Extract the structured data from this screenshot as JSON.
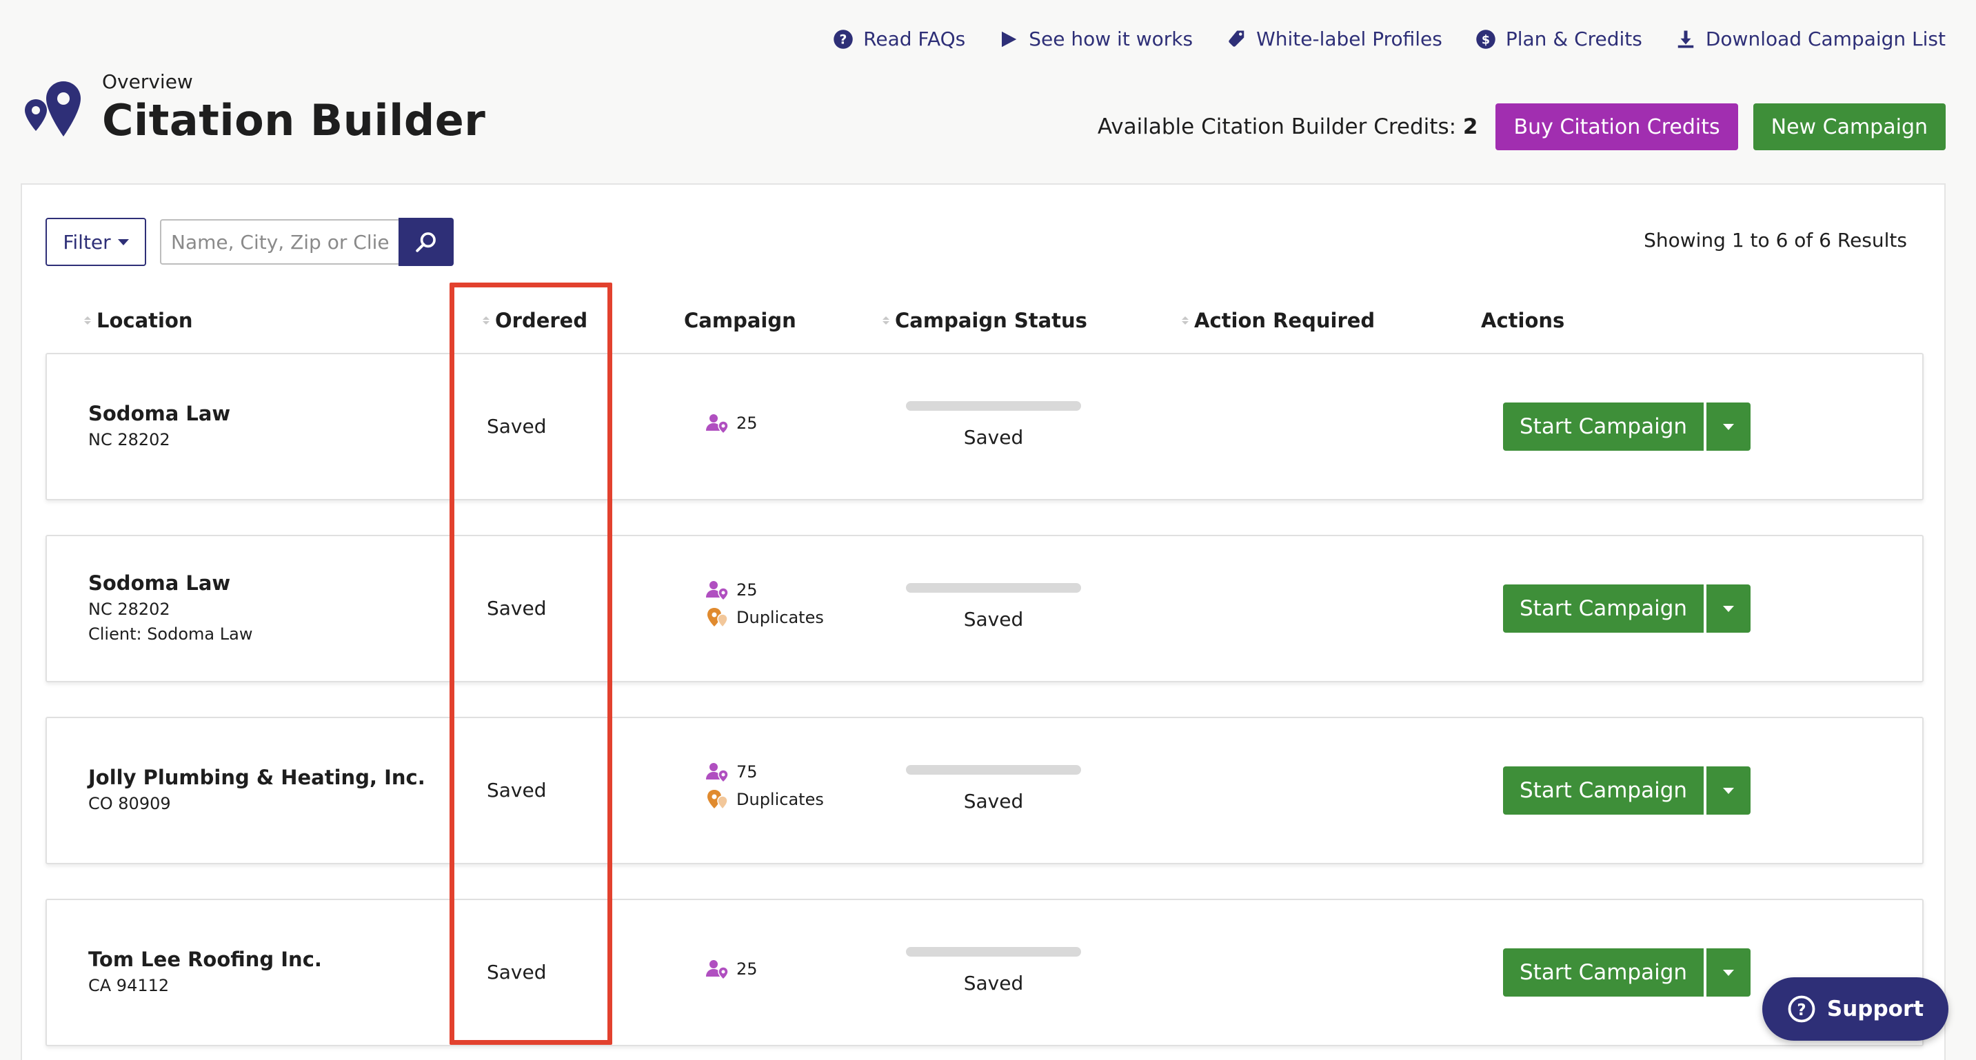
{
  "top_links": [
    {
      "label": "Read FAQs",
      "icon": "question-circle-icon"
    },
    {
      "label": "See how it works",
      "icon": "play-icon"
    },
    {
      "label": "White-label Profiles",
      "icon": "tag-icon"
    },
    {
      "label": "Plan & Credits",
      "icon": "dollar-circle-icon"
    },
    {
      "label": "Download Campaign List",
      "icon": "download-icon"
    }
  ],
  "header": {
    "overline": "Overview",
    "title": "Citation Builder",
    "credits_label": "Available Citation Builder Credits:",
    "credits_value": "2",
    "buy_button": "Buy Citation Credits",
    "new_button": "New Campaign"
  },
  "toolbar": {
    "filter_label": "Filter",
    "search_placeholder": "Name, City, Zip or Client",
    "results_text": "Showing 1 to 6 of 6 Results"
  },
  "columns": {
    "location": "Location",
    "ordered": "Ordered",
    "campaign": "Campaign",
    "campaign_status": "Campaign Status",
    "action_required": "Action Required",
    "actions": "Actions"
  },
  "rows": [
    {
      "name": "Sodoma Law",
      "zip": "NC 28202",
      "client": "",
      "ordered": "Saved",
      "campaign_count": "25",
      "duplicates": "",
      "status": "Saved",
      "action_label": "Start Campaign"
    },
    {
      "name": "Sodoma Law",
      "zip": "NC 28202",
      "client": "Client: Sodoma Law",
      "ordered": "Saved",
      "campaign_count": "25",
      "duplicates": "Duplicates",
      "status": "Saved",
      "action_label": "Start Campaign"
    },
    {
      "name": "Jolly Plumbing & Heating, Inc.",
      "zip": "CO 80909",
      "client": "",
      "ordered": "Saved",
      "campaign_count": "75",
      "duplicates": "Duplicates",
      "status": "Saved",
      "action_label": "Start Campaign"
    },
    {
      "name": "Tom Lee Roofing Inc.",
      "zip": "CA 94112",
      "client": "",
      "ordered": "Saved",
      "campaign_count": "25",
      "duplicates": "",
      "status": "Saved",
      "action_label": "Start Campaign"
    }
  ],
  "support_label": "Support",
  "colors": {
    "brand_navy": "#2e2f77",
    "purple": "#a12eb0",
    "green": "#3e8f39",
    "highlight_red": "#e2412e",
    "people_icon": "#b04fc0",
    "duplicate_icon": "#e08a2e"
  }
}
